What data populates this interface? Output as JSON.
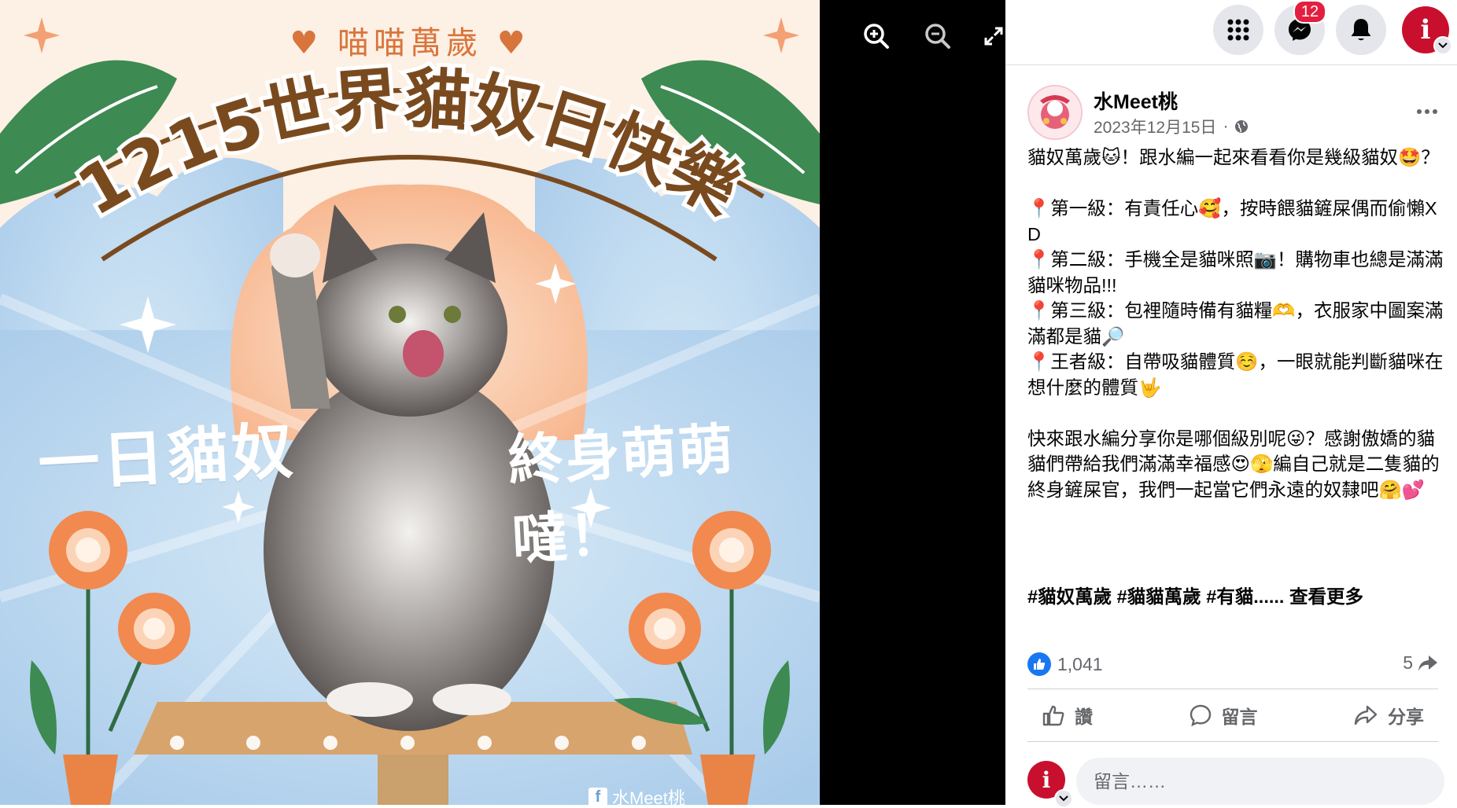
{
  "image": {
    "top_tagline": "♥ 喵喵萬歲 ♥",
    "title": "1215世界貓奴日快樂",
    "left_phrase": "一日貓奴",
    "right_phrase": "終身萌萌噠！",
    "watermark": "水Meet桃",
    "watermark_icon": "f"
  },
  "viewer_controls": {
    "zoom_in": "zoom-in-icon",
    "zoom_out": "zoom-out-icon",
    "fullscreen": "fullscreen-icon"
  },
  "top_nav": {
    "messenger_badge": "12",
    "profile_letter": "i"
  },
  "post": {
    "page_name": "水Meet桃",
    "date": "2023年12月15日",
    "separator": "·",
    "body": "貓奴萬歲🐱！跟水編一起來看看你是幾級貓奴🤩？\n\n📍第一級：有責任心🥰，按時餵貓鏟屎偶而偷懶XD\n📍第二級：手機全是貓咪照📷！購物車也總是滿滿貓咪物品!!!\n📍第三級：包裡隨時備有貓糧🫶，衣服家中圖案滿滿都是貓🔎\n📍王者級：自帶吸貓體質☺️，一眼就能判斷貓咪在想什麼的體質🤟\n\n快來跟水編分享你是哪個級別呢😜？感謝傲嬌的貓貓們帶給我們滿滿幸福感😍🫣編自己就是二隻貓的終身鏟屎官，我們一起當它們永遠的奴隸吧🤗💕",
    "tags": "#貓奴萬歲 #貓貓萬歲 #有貓......",
    "see_more": "查看更多",
    "like_count": "1,041",
    "share_count": "5"
  },
  "actions": {
    "like": "讚",
    "comment": "留言",
    "share": "分享"
  },
  "comment_box": {
    "placeholder": "留言……",
    "avatar_letter": "i"
  },
  "colors": {
    "fb_blue": "#1877f2",
    "badge_red": "#e41e3f",
    "profile_red": "#c8102e",
    "promo_brown": "#7a4a1f",
    "promo_orange": "#d8753c"
  }
}
